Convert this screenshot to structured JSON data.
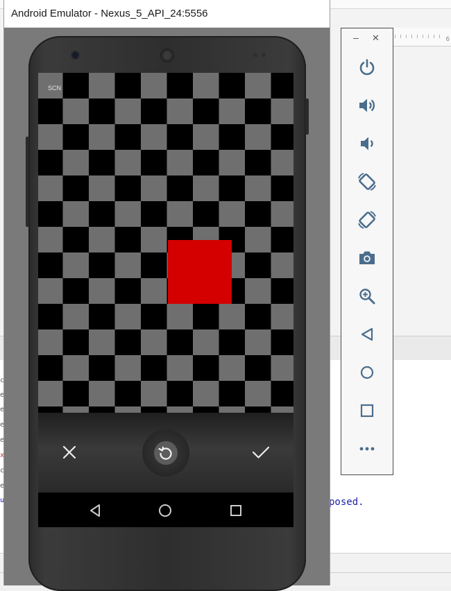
{
  "emulator": {
    "title": "Android Emulator - Nexus_5_API_24:5556"
  },
  "screen": {
    "overlay_label": "SCN"
  },
  "camera_controls": {
    "cancel_icon": "close-icon",
    "retake_icon": "rotate-icon",
    "confirm_icon": "check-icon"
  },
  "nav_bar": {
    "back_icon": "back-triangle-icon",
    "home_icon": "home-circle-icon",
    "recents_icon": "recents-square-icon"
  },
  "toolbar": {
    "minimize_label": "–",
    "close_label": "✕",
    "buttons": [
      {
        "icon": "power-icon"
      },
      {
        "icon": "volume-up-icon"
      },
      {
        "icon": "volume-down-icon"
      },
      {
        "icon": "rotate-left-icon"
      },
      {
        "icon": "rotate-right-icon"
      },
      {
        "icon": "camera-icon"
      },
      {
        "icon": "zoom-icon"
      },
      {
        "icon": "back-icon"
      },
      {
        "icon": "home-icon"
      },
      {
        "icon": "overview-icon"
      },
      {
        "icon": "more-icon"
      }
    ]
  },
  "ide": {
    "ruler_number": "6",
    "console_text": "posed.",
    "console_letters": [
      "c",
      "e",
      "e",
      "e",
      "e",
      "x",
      "c",
      "e",
      "u"
    ]
  },
  "colors": {
    "toolbar_icon": "#4a6d8c",
    "red_square": "#d40000",
    "checker_gray": "#6f6f6f",
    "console_text": "#1d1dab"
  }
}
